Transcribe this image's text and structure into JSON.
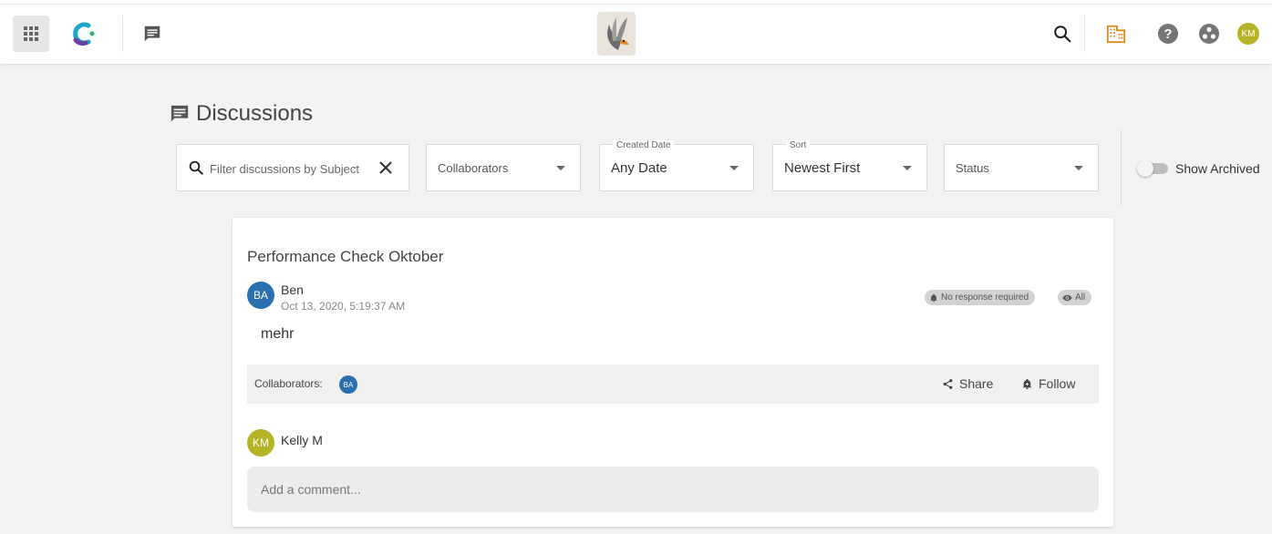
{
  "topbar": {
    "icons": {
      "apps": "apps-grid-icon",
      "brand": "brand-ring-icon",
      "discussions": "chat-bubble-icon",
      "logo": "bird-logo",
      "search": "search-icon",
      "organization": "building-icon",
      "help": "help-circle-icon",
      "hub": "hub-icon"
    },
    "user_initials": "KM"
  },
  "page": {
    "title": "Discussions"
  },
  "filters": {
    "search_placeholder": "Filter discussions by Subject",
    "collaborators_placeholder": "Collaborators",
    "created_date_label": "Created Date",
    "created_date_value": "Any Date",
    "sort_label": "Sort",
    "sort_value": "Newest First",
    "status_placeholder": "Status",
    "show_archived_label": "Show Archived",
    "show_archived": false
  },
  "discussion": {
    "title": "Performance Check Oktober",
    "author_initials": "BA",
    "author": "Ben",
    "timestamp": "Oct 13, 2020, 5:19:37 AM",
    "badge_response": "No response required",
    "badge_visibility": "All",
    "body": "mehr",
    "collaborators_label": "Collaborators:",
    "collaborators": [
      "BA"
    ],
    "share_label": "Share",
    "follow_label": "Follow",
    "commenter_initials": "KM",
    "commenter": "Kelly M",
    "comment_placeholder": "Add a comment..."
  },
  "colors": {
    "avatar_ba": "#2a6fae",
    "avatar_km": "#b5b427",
    "org_icon": "#e0891c",
    "brand_ring": "#1ea6c8"
  }
}
